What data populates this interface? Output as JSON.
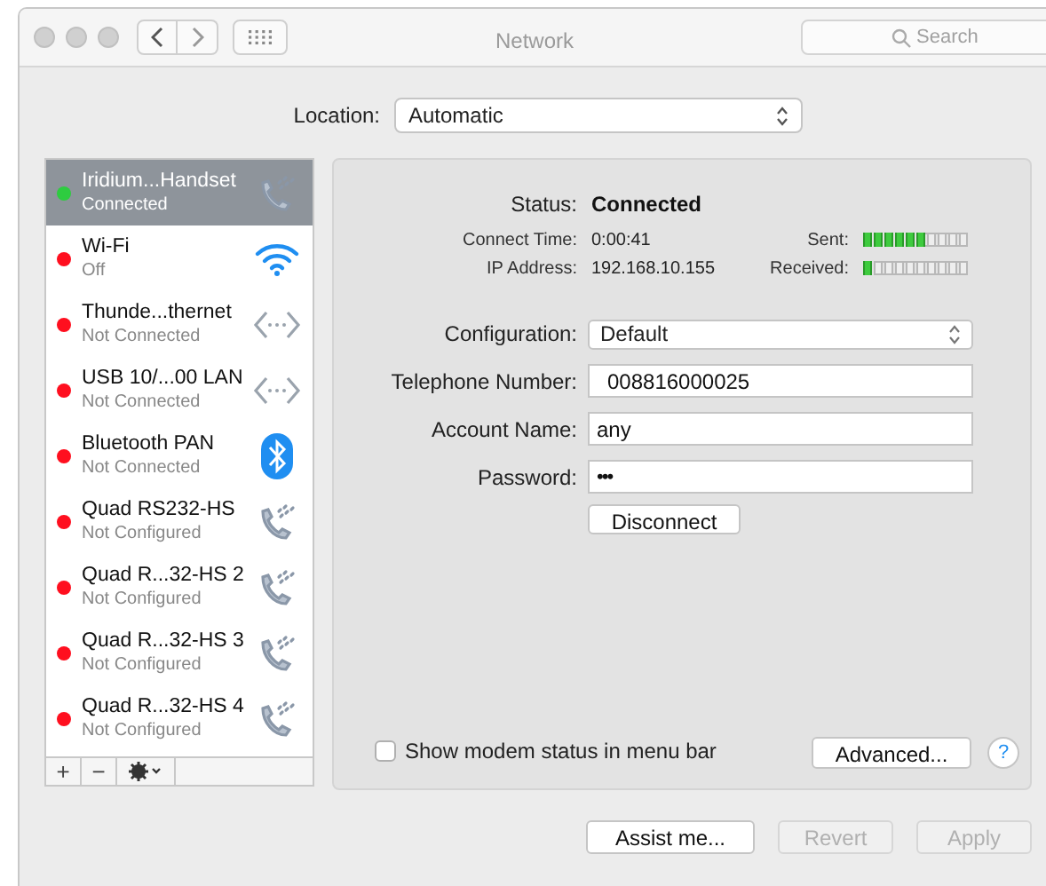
{
  "window": {
    "title": "Network"
  },
  "search": {
    "placeholder": "Search"
  },
  "location": {
    "label": "Location:",
    "value": "Automatic"
  },
  "services": [
    {
      "name": "Iridium...Handset",
      "status": "Connected",
      "color": "#2ecc40",
      "kind": "phone",
      "selected": true
    },
    {
      "name": "Wi-Fi",
      "status": "Off",
      "color": "#ff0f1f",
      "kind": "wifi",
      "selected": false
    },
    {
      "name": "Thunde...thernet",
      "status": "Not Connected",
      "color": "#ff0f1f",
      "kind": "ethernet",
      "selected": false
    },
    {
      "name": "USB 10/...00 LAN",
      "status": "Not Connected",
      "color": "#ff0f1f",
      "kind": "ethernet",
      "selected": false
    },
    {
      "name": "Bluetooth PAN",
      "status": "Not Connected",
      "color": "#ff0f1f",
      "kind": "bluetooth",
      "selected": false
    },
    {
      "name": "Quad RS232-HS",
      "status": "Not Configured",
      "color": "#ff0f1f",
      "kind": "phone",
      "selected": false
    },
    {
      "name": "Quad R...32-HS 2",
      "status": "Not Configured",
      "color": "#ff0f1f",
      "kind": "phone",
      "selected": false
    },
    {
      "name": "Quad R...32-HS 3",
      "status": "Not Configured",
      "color": "#ff0f1f",
      "kind": "phone",
      "selected": false
    },
    {
      "name": "Quad R...32-HS 4",
      "status": "Not Configured",
      "color": "#ff0f1f",
      "kind": "phone",
      "selected": false
    }
  ],
  "list_toolbar": [
    "+",
    "−"
  ],
  "status": {
    "label": "Status:",
    "value": "Connected"
  },
  "connect_time": {
    "label": "Connect Time:",
    "value": "0:00:41"
  },
  "ip_address": {
    "label": "IP Address:",
    "value": "192.168.10.155"
  },
  "sent": {
    "label": "Sent:",
    "level": 0.6
  },
  "received": {
    "label": "Received:",
    "level": 0.1
  },
  "configuration": {
    "label": "Configuration:",
    "value": "Default"
  },
  "fields": [
    {
      "label": "Telephone Number:",
      "value": "008816000025",
      "kind": "text"
    },
    {
      "label": "Account Name:",
      "value": "any",
      "kind": "text"
    },
    {
      "label": "Password:",
      "value": "•••",
      "kind": "password"
    }
  ],
  "disconnect_button": "Disconnect",
  "show_modem_status": {
    "label": "Show modem status in menu bar",
    "checked": false
  },
  "advanced_button": "Advanced...",
  "help": "?",
  "buttons": [
    {
      "label": "Assist me...",
      "disabled": false
    },
    {
      "label": "Revert",
      "disabled": true
    },
    {
      "label": "Apply",
      "disabled": true
    }
  ]
}
